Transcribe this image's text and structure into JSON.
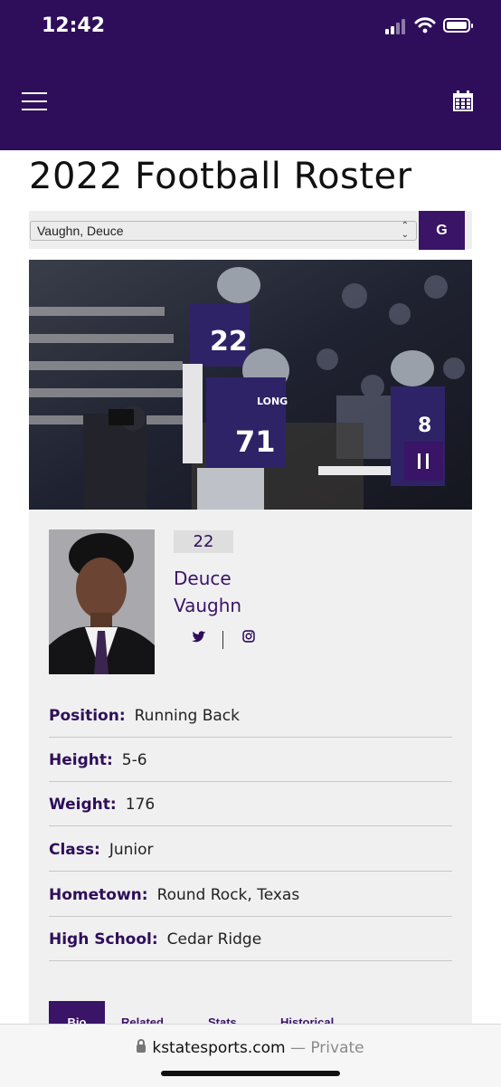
{
  "status_bar": {
    "time": "12:42"
  },
  "page": {
    "title": "2022 Football Roster"
  },
  "roster_select": {
    "selected": "Vaughn, Deuce",
    "go_label": "G"
  },
  "player": {
    "jersey_number": "22",
    "first_name": "Deuce",
    "last_name": "Vaughn",
    "social": [
      "twitter-icon",
      "instagram-icon"
    ]
  },
  "info": [
    {
      "label": "Position:",
      "value": "Running Back"
    },
    {
      "label": "Height:",
      "value": "5-6"
    },
    {
      "label": "Weight:",
      "value": "176"
    },
    {
      "label": "Class:",
      "value": "Junior"
    },
    {
      "label": "Hometown:",
      "value": "Round Rock, Texas"
    },
    {
      "label": "High School:",
      "value": "Cedar Ridge"
    }
  ],
  "tabs": [
    "Bio",
    "Related",
    "Stats",
    "Historical"
  ],
  "browser": {
    "domain": "kstatesports.com",
    "mode": "— Private"
  },
  "colors": {
    "brand_purple": "#2e0e5a",
    "accent_purple": "#3a1466"
  }
}
